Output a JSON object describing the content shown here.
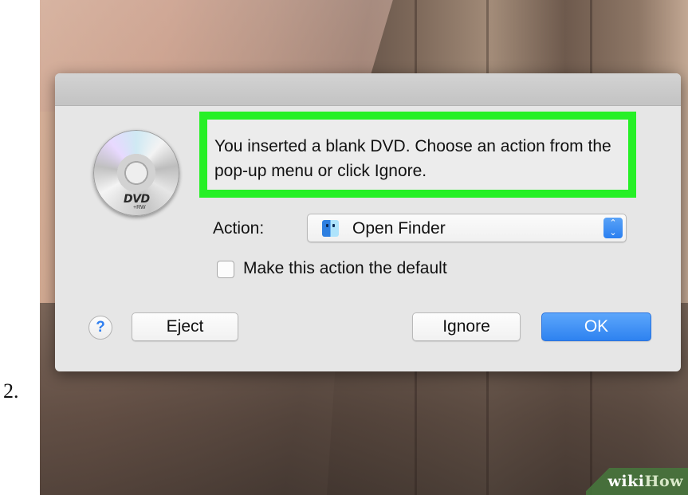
{
  "step_number": "2.",
  "watermark": {
    "part1": "wiki",
    "part2": "How"
  },
  "dialog": {
    "disc_icon": {
      "name": "dvd-disc-icon",
      "label": "DVD",
      "sublabel": "+RW"
    },
    "message": "You inserted a blank DVD. Choose an action from the pop-up menu or click Ignore.",
    "highlight_color": "#26f026",
    "action": {
      "label": "Action:",
      "selected_value": "Open Finder",
      "selected_icon": "finder-icon"
    },
    "default_checkbox": {
      "label": "Make this action the default",
      "checked": false
    },
    "buttons": {
      "help": "?",
      "eject": "Eject",
      "ignore": "Ignore",
      "ok": "OK"
    },
    "accent_color": "#2e82f0"
  }
}
